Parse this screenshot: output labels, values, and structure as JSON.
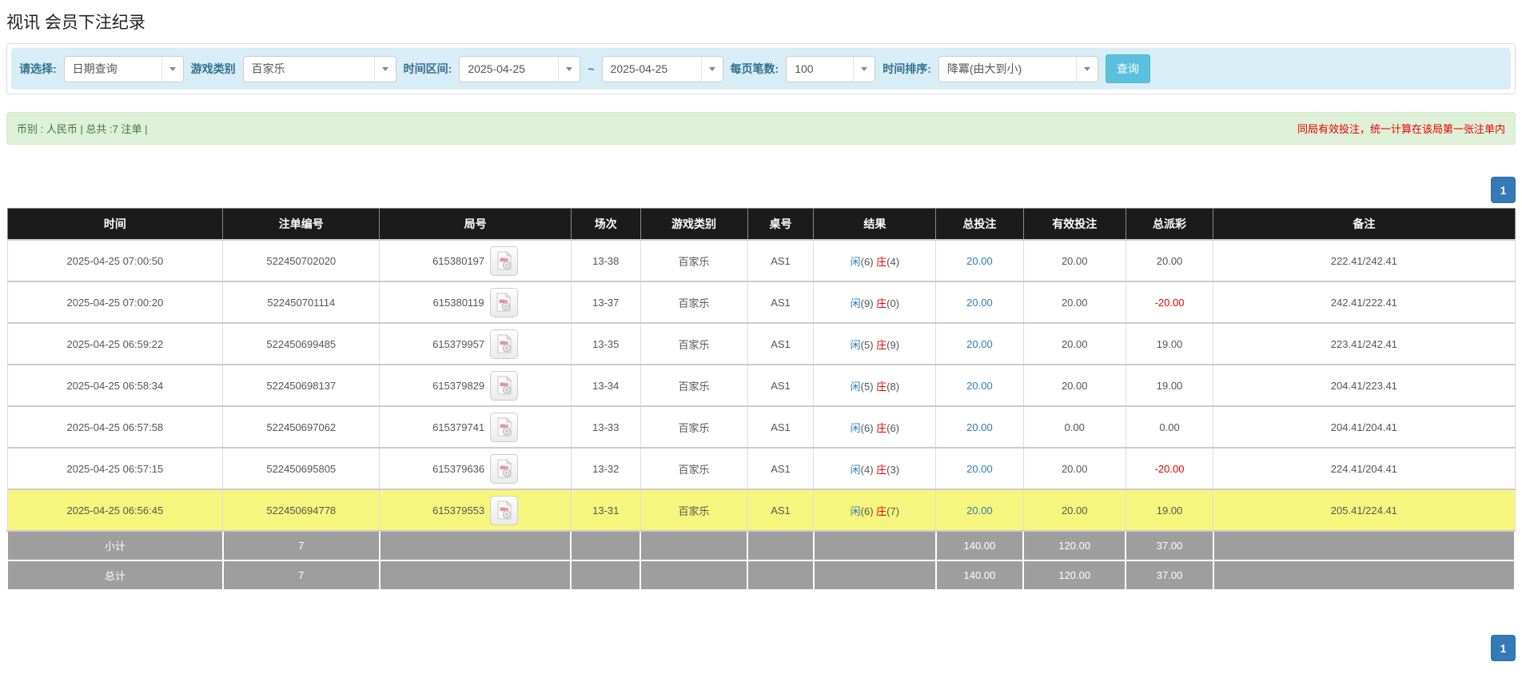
{
  "page": {
    "title": "视讯 会员下注纪录"
  },
  "filters": {
    "query_type": {
      "label": "请选择:",
      "value": "日期查询"
    },
    "game_category": {
      "label": "游戏类别",
      "value": "百家乐"
    },
    "time_range": {
      "label": "时间区间:",
      "from": "2025-04-25",
      "separator": "~",
      "to": "2025-04-25"
    },
    "page_size": {
      "label": "每页笔数:",
      "value": "100"
    },
    "time_sort": {
      "label": "时间排序:",
      "value": "降冪(由大到小)"
    },
    "search_button": "查询"
  },
  "summary": {
    "left": "币别 : 人民币 | 总共 :7 注单 |",
    "right_notice": "同局有效投注，统一计算在该局第一张注单内"
  },
  "pagination": {
    "page": "1"
  },
  "table": {
    "headers": [
      "时间",
      "注单编号",
      "局号",
      "场次",
      "游戏类别",
      "桌号",
      "结果",
      "总投注",
      "有效投注",
      "总派彩",
      "备注"
    ],
    "result_labels": {
      "player": "闲",
      "banker": "庄"
    },
    "rows": [
      {
        "time": "2025-04-25 07:00:50",
        "bet_id": "522450702020",
        "round_id": "615380197",
        "session": "13-38",
        "game": "百家乐",
        "table_no": "AS1",
        "result": {
          "player": "6",
          "banker": "4"
        },
        "total_bet": "20.00",
        "valid_bet": "20.00",
        "payout": "20.00",
        "note": "222.41/242.41",
        "highlighted": false
      },
      {
        "time": "2025-04-25 07:00:20",
        "bet_id": "522450701114",
        "round_id": "615380119",
        "session": "13-37",
        "game": "百家乐",
        "table_no": "AS1",
        "result": {
          "player": "9",
          "banker": "0"
        },
        "total_bet": "20.00",
        "valid_bet": "20.00",
        "payout": "-20.00",
        "note": "242.41/222.41",
        "highlighted": false
      },
      {
        "time": "2025-04-25 06:59:22",
        "bet_id": "522450699485",
        "round_id": "615379957",
        "session": "13-35",
        "game": "百家乐",
        "table_no": "AS1",
        "result": {
          "player": "5",
          "banker": "9"
        },
        "total_bet": "20.00",
        "valid_bet": "20.00",
        "payout": "19.00",
        "note": "223.41/242.41",
        "highlighted": false
      },
      {
        "time": "2025-04-25 06:58:34",
        "bet_id": "522450698137",
        "round_id": "615379829",
        "session": "13-34",
        "game": "百家乐",
        "table_no": "AS1",
        "result": {
          "player": "5",
          "banker": "8"
        },
        "total_bet": "20.00",
        "valid_bet": "20.00",
        "payout": "19.00",
        "note": "204.41/223.41",
        "highlighted": false
      },
      {
        "time": "2025-04-25 06:57:58",
        "bet_id": "522450697062",
        "round_id": "615379741",
        "session": "13-33",
        "game": "百家乐",
        "table_no": "AS1",
        "result": {
          "player": "6",
          "banker": "6"
        },
        "total_bet": "20.00",
        "valid_bet": "0.00",
        "payout": "0.00",
        "note": "204.41/204.41",
        "highlighted": false
      },
      {
        "time": "2025-04-25 06:57:15",
        "bet_id": "522450695805",
        "round_id": "615379636",
        "session": "13-32",
        "game": "百家乐",
        "table_no": "AS1",
        "result": {
          "player": "4",
          "banker": "3"
        },
        "total_bet": "20.00",
        "valid_bet": "20.00",
        "payout": "-20.00",
        "note": "224.41/204.41",
        "highlighted": false
      },
      {
        "time": "2025-04-25 06:56:45",
        "bet_id": "522450694778",
        "round_id": "615379553",
        "session": "13-31",
        "game": "百家乐",
        "table_no": "AS1",
        "result": {
          "player": "6",
          "banker": "7"
        },
        "total_bet": "20.00",
        "valid_bet": "20.00",
        "payout": "19.00",
        "note": "205.41/224.41",
        "highlighted": true
      }
    ],
    "footer": [
      {
        "label": "小计",
        "count": "7",
        "total_bet": "140.00",
        "valid_bet": "120.00",
        "payout": "37.00"
      },
      {
        "label": "总计",
        "count": "7",
        "total_bet": "140.00",
        "valid_bet": "120.00",
        "payout": "37.00"
      }
    ]
  },
  "colors": {
    "link_blue": "#337ab7",
    "negative_red": "#e60000",
    "notice_red": "#e60000",
    "banker_red": "#e60000",
    "player_blue": "#337ab7",
    "highlight_yellow": "#f6f67e",
    "table_header_black": "#1b1b1b",
    "footer_gray": "#9e9e9e",
    "filter_bar_bg": "#d9edf7",
    "filter_label_blue": "#31708f",
    "summary_bg": "#dff0d8",
    "search_button_bg": "#5bc0de",
    "pagination_bg": "#337ab7"
  }
}
